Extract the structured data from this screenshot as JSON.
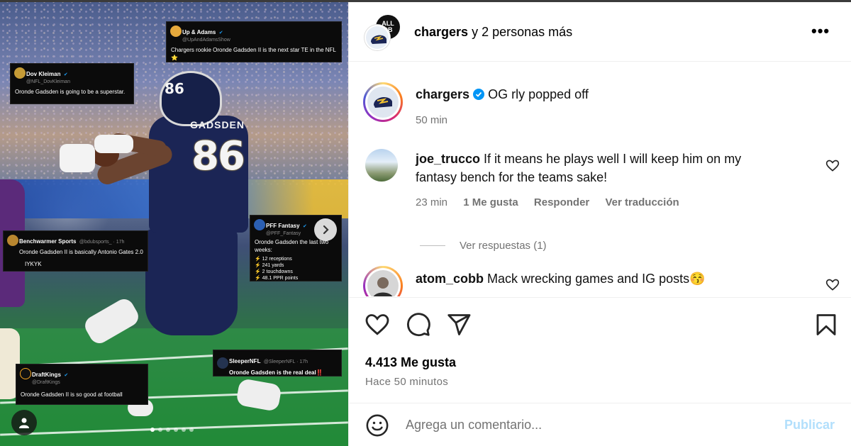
{
  "media": {
    "cards": [
      {
        "name": "Up & Adams",
        "handle": "@UpAndAdamsShow",
        "text": "Chargers rookie Oronde Gadsden II is the next star TE in the NFL ⭐"
      },
      {
        "name": "Dov Kleiman",
        "handle": "@NFL_DovKleiman",
        "text": "Oronde Gadsden is going to be a superstar."
      },
      {
        "name": "Benchwarmer Sports",
        "handle": "@bdubsports_ · 17h",
        "text": "Oronde Gadsden II is basically Antonio Gates 2.0",
        "text2": "IYKYK"
      },
      {
        "name": "PFF Fantasy",
        "handle": "@PFF_Fantasy",
        "text": "Oronde Gadsden the last two weeks:",
        "lines": [
          "⚡ 12 receptions",
          "⚡ 241 yards",
          "⚡ 2 touchdowns",
          "⚡ 48.1 PPR points"
        ]
      },
      {
        "name": "SleeperNFL",
        "handle": "@SleeperNFL · 17h",
        "text": "Oronde Gadsden is the real deal‼️"
      },
      {
        "name": "DraftKings",
        "handle": "@DraftKings",
        "text": "Oronde Gadsden II is so good at football"
      }
    ],
    "jersey_number": "86",
    "jersey_name": "GADSDEN",
    "next_icon": "chevron-right-icon",
    "slide_count": 6,
    "active_slide": 1
  },
  "header": {
    "username": "chargers",
    "suffix": "y 2 personas más",
    "collab_avatar_text": "ALL\nDB",
    "more_icon": "more-horizontal-icon",
    "more_label": "•••"
  },
  "caption": {
    "username": "chargers",
    "text": "OG rly popped off",
    "time": "50 min",
    "verified_icon": "verified-badge-icon"
  },
  "comments": [
    {
      "username": "joe_trucco",
      "text_line1": "If it means he plays well I will keep him on my",
      "text_line2": "fantasy bench for the teams sake!",
      "time": "23 min",
      "likes": "1 Me gusta",
      "reply": "Responder",
      "translate": "Ver traducción"
    },
    {
      "username": "atom_cobb",
      "text": "Mack wrecking games and IG posts😚"
    }
  ],
  "view_replies": "Ver respuestas (1)",
  "actions": {
    "like_icon": "heart-icon",
    "comment_icon": "comment-icon",
    "share_icon": "send-icon",
    "save_icon": "bookmark-icon"
  },
  "likes": "4.413 Me gusta",
  "posted_ago": "Hace 50 minutos",
  "add_comment": {
    "placeholder": "Agrega un comentario...",
    "publish": "Publicar",
    "emoji_icon": "emoji-icon"
  },
  "colors": {
    "publish_disabled": "#b2dffc",
    "verified": "#0095f6",
    "meta_gray": "#737373"
  }
}
